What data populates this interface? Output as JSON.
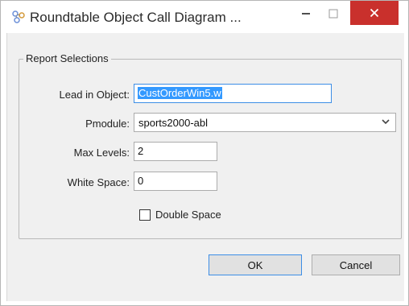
{
  "window": {
    "title": "Roundtable Object Call Diagram ...",
    "app_icon": "roundtable-icon",
    "controls": {
      "minimize": "–",
      "maximize": "☐",
      "close": "✕"
    }
  },
  "group": {
    "legend": "Report Selections",
    "lead_in": {
      "label": "Lead in Object:",
      "value": "CustOrderWin5.w"
    },
    "pmodule": {
      "label": "Pmodule:",
      "value": "sports2000-abl"
    },
    "max_levels": {
      "label": "Max Levels:",
      "value": "2"
    },
    "white_space": {
      "label": "White Space:",
      "value": "0"
    },
    "double_space": {
      "label": "Double Space",
      "checked": false
    }
  },
  "buttons": {
    "ok": "OK",
    "cancel": "Cancel"
  },
  "colors": {
    "close_button": "#c9302c",
    "selection": "#3399ff",
    "focus_border": "#3d8ee6"
  }
}
